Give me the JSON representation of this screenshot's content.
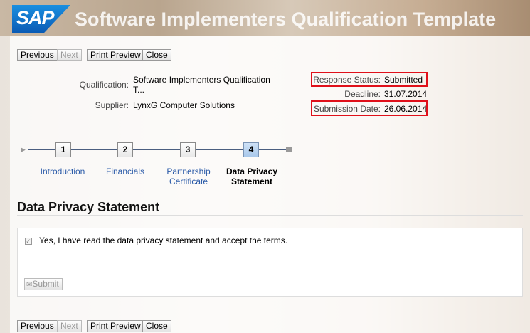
{
  "header": {
    "logo": "SAP",
    "title": "Software Implementers Qualification Template"
  },
  "toolbar": {
    "previous": "Previous",
    "next": "Next",
    "print_preview": "Print Preview",
    "close": "Close"
  },
  "info": {
    "qualification_label": "Qualification:",
    "qualification_value_line1": "Software Implementers Qualification",
    "qualification_value_line2": "T...",
    "supplier_label": "Supplier:",
    "supplier_value": "LynxG Computer Solutions",
    "response_status_label": "Response Status:",
    "response_status_value": "Submitted",
    "deadline_label": "Deadline:",
    "deadline_value": "31.07.2014",
    "submission_date_label": "Submission Date:",
    "submission_date_value": "26.06.2014"
  },
  "steps": [
    {
      "num": "1",
      "label1": "Introduction",
      "label2": ""
    },
    {
      "num": "2",
      "label1": "Financials",
      "label2": ""
    },
    {
      "num": "3",
      "label1": "Partnership",
      "label2": "Certificate"
    },
    {
      "num": "4",
      "label1": "Data Privacy",
      "label2": "Statement"
    }
  ],
  "section": {
    "title": "Data Privacy Statement",
    "checkbox_label": "Yes, I have read the data privacy statement and accept the terms.",
    "checked": true,
    "submit": "Submit"
  }
}
